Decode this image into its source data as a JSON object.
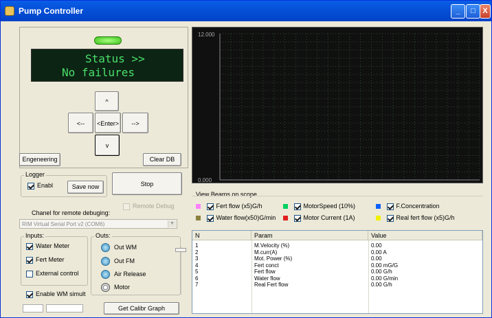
{
  "window": {
    "title": "Pump Controller",
    "min": "_",
    "max": "□",
    "close": "X"
  },
  "lcd": {
    "line1": "Status >>",
    "line2": "No failures"
  },
  "nav": {
    "up": "^",
    "left": "<--",
    "enter": "<Enter>",
    "right": "-->",
    "down": "v"
  },
  "buttons": {
    "engineering": "Engeneering",
    "clear_db": "Clear DB",
    "save_now": "Save now",
    "stop": "Stop",
    "calib": "Get Calibr Graph"
  },
  "logger": {
    "label": "Logger",
    "enable": "Enabl",
    "enable_checked": true
  },
  "remote_debug": {
    "label": "Remote Debug",
    "checked": false
  },
  "remote_port": {
    "label": "Chanel for remote debuging:",
    "value": "RIM Virtual Serial Port v2 (COM6)"
  },
  "inputs": {
    "label": "Inputs:",
    "items": [
      {
        "label": "Water Meter",
        "checked": true
      },
      {
        "label": "Fert Meter",
        "checked": true
      },
      {
        "label": "External control",
        "checked": false
      }
    ]
  },
  "outs": {
    "label": "Outs:",
    "items": [
      "Out WM",
      "Out FM",
      "Air Release",
      "Motor"
    ]
  },
  "wm_simult": {
    "label": "Enable WM simult",
    "checked": true
  },
  "scope": {
    "ymax": "12.000",
    "ymin": "0.000",
    "grid": true,
    "background": "#101010",
    "grid_color": "#2f4a2f"
  },
  "beams": {
    "label": "View Beams on scope",
    "items": [
      {
        "label": "Fert flow (x5)G/h",
        "color": "#ff80ff",
        "checked": true
      },
      {
        "label": "MotorSpeed (10%)",
        "color": "#00d060",
        "checked": true
      },
      {
        "label": "F.Concentration",
        "color": "#1060ff",
        "checked": true
      },
      {
        "label": "Water flow(x50)G/min",
        "color": "#8a8040",
        "checked": true
      },
      {
        "label": "Motor Current (1A)",
        "color": "#e02020",
        "checked": true
      },
      {
        "label": "Real fert flow (x5)G/h",
        "color": "#f0f000",
        "checked": true
      }
    ]
  },
  "table": {
    "columns": [
      "N",
      "Param",
      "Value"
    ],
    "rows": [
      {
        "n": "1",
        "param": "M.Velocity (%)",
        "value": "0.00"
      },
      {
        "n": "2",
        "param": "M.curr(A)",
        "value": "0.00 A"
      },
      {
        "n": "3",
        "param": "Mot. Power (%)",
        "value": "0.00"
      },
      {
        "n": "4",
        "param": "Fert conct",
        "value": "0.00  mG/G"
      },
      {
        "n": "5",
        "param": "Fert flow",
        "value": "0.00  G/h"
      },
      {
        "n": "6",
        "param": "Water flow",
        "value": "0.00 G/min"
      },
      {
        "n": "7",
        "param": "Real Fert flow",
        "value": "0.00 G/h"
      }
    ]
  }
}
